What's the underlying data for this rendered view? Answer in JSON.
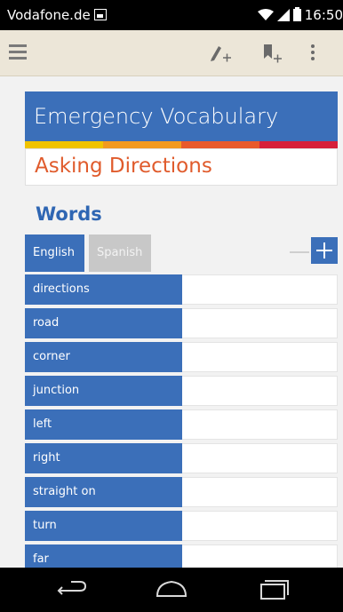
{
  "status_bar": {
    "carrier": "Vodafone.de",
    "time": "16:50"
  },
  "toolbar": {
    "icons": [
      "menu-icon",
      "edit-add-icon",
      "bookmark-add-icon",
      "more-vert-icon"
    ]
  },
  "header": {
    "title": "Emergency Vocabulary",
    "subtitle": "Asking Directions",
    "stripe_colors": [
      "#f0c300",
      "#f29a1f",
      "#e85a2b",
      "#d61f3a"
    ]
  },
  "words_section": {
    "heading": "Words",
    "tabs": [
      {
        "label": "English",
        "active": true
      },
      {
        "label": "Spanish",
        "active": false
      }
    ],
    "rows": [
      {
        "word": "directions",
        "translation": ""
      },
      {
        "word": "road",
        "translation": ""
      },
      {
        "word": "corner",
        "translation": ""
      },
      {
        "word": "junction",
        "translation": ""
      },
      {
        "word": "left",
        "translation": ""
      },
      {
        "word": "right",
        "translation": ""
      },
      {
        "word": "straight on",
        "translation": ""
      },
      {
        "word": "turn",
        "translation": ""
      },
      {
        "word": "far",
        "translation": ""
      }
    ]
  },
  "colors": {
    "accent_blue": "#3b6fb9",
    "subtitle_orange": "#e05b2c",
    "toolbar_bg": "#ece6d8"
  }
}
